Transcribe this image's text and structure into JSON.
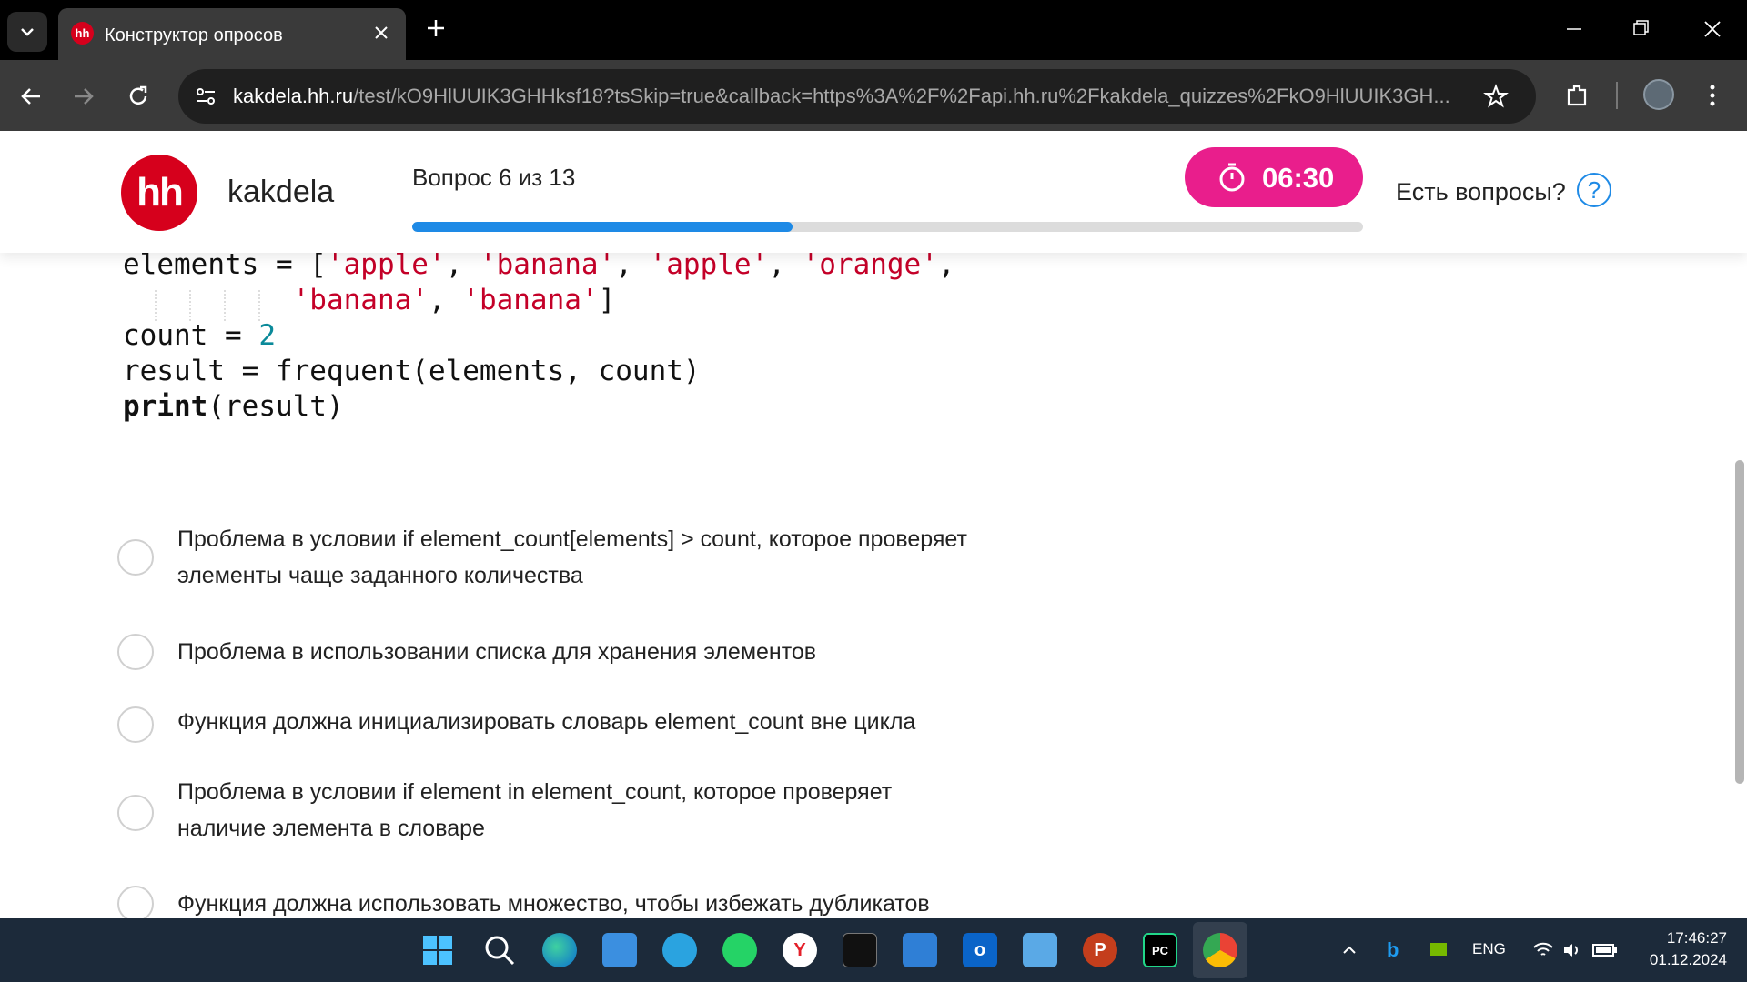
{
  "browser": {
    "tab_title": "Конструктор опросов",
    "favicon_text": "hh",
    "url_domain": "kakdela.hh.ru",
    "url_path": "/test/kO9HlUUIK3GHHksf18?tsSkip=true&callback=https%3A%2F%2Fapi.hh.ru%2Fkakdela_quizzes%2FkO9HlUUIK3GH..."
  },
  "header": {
    "logo_text": "hh",
    "brand": "kakdela",
    "question_counter": "Вопрос 6 из 13",
    "progress_fraction": 0.4,
    "timer": "06:30",
    "help_text": "Есть вопросы?",
    "help_icon_text": "?"
  },
  "code": {
    "line1_var": "elements",
    "line1_op": " = [",
    "s1": "'apple'",
    "s2": "'banana'",
    "s3": "'apple'",
    "s4": "'orange'",
    "s5": "'banana'",
    "s6": "'banana'",
    "line3_var": "count",
    "line3_op": " = ",
    "line3_num": "2",
    "line4": "result = frequent(elements, count)",
    "line5_kw": "print",
    "line5_rest": "(result)"
  },
  "options": [
    {
      "line1": "Проблема в условии if element_count[elements] > count, которое проверяет",
      "line2": "элементы чаще заданного количества"
    },
    {
      "line1": "Проблема в использовании списка для хранения элементов",
      "line2": ""
    },
    {
      "line1": "Функция должна инициализировать словарь element_count вне цикла",
      "line2": ""
    },
    {
      "line1": "Проблема в условии if element in element_count, которое проверяет",
      "line2": "наличие элемента в словаре"
    },
    {
      "line1": "Функция должна использовать множество, чтобы избежать дубликатов",
      "line2": ""
    }
  ],
  "taskbar": {
    "language": "ENG",
    "time": "17:46:27",
    "date": "01.12.2024"
  },
  "colors": {
    "brand_red": "#d6001c",
    "timer_pink": "#e91e8c",
    "progress_blue": "#1e8ae6"
  }
}
